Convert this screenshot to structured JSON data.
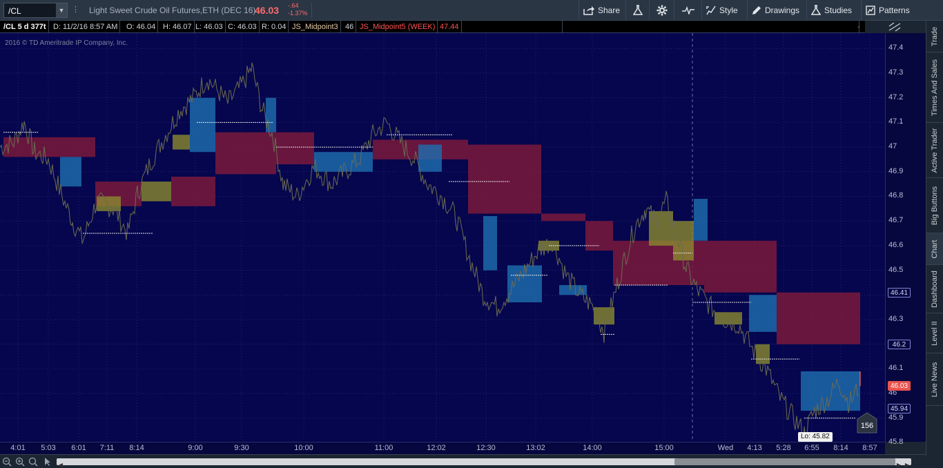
{
  "toolbar": {
    "symbol": "/CL",
    "instrument_name": "Light Sweet Crude Oil Futures,ETH (DEC 16)",
    "last_price": "46.03",
    "change": "-.64",
    "change_pct": "-1.37%",
    "share_label": "Share",
    "style_label": "Style",
    "drawings_label": "Drawings",
    "studies_label": "Studies",
    "patterns_label": "Patterns"
  },
  "chart_header": {
    "title": "/CL 5 d 377t",
    "date": "D: 11/2/16 8:57 AM",
    "open": "O: 46.04",
    "high": "H: 46.07",
    "low": "L: 46.03",
    "close": "C: 46.03",
    "range": "R: 0.04",
    "indicator1_name": "JS_Midpoint3",
    "indicator1_value": "46",
    "indicator2_name": "JS_Midpoint5 (WEEK)",
    "indicator2_value": "47.44"
  },
  "watermark": "2016 © TD Ameritrade IP Company, Inc.",
  "price_axis": {
    "labels": [
      "47.4",
      "47.3",
      "47.2",
      "47.1",
      "47",
      "46.9",
      "46.8",
      "46.7",
      "46.6",
      "46.5",
      "46.4",
      "46.3",
      "46.2",
      "46.1",
      "46",
      "45.9",
      "45.8"
    ],
    "tags": [
      {
        "value": "46.41",
        "color": "#d4d9ff",
        "bg": "#06073f",
        "border": "#8088d8"
      },
      {
        "value": "46.2",
        "color": "#d4d9ff",
        "bg": "#06073f",
        "border": "#8088d8"
      },
      {
        "value": "46.03",
        "color": "#ffffff",
        "bg": "#e8544e",
        "border": "#e8544e"
      },
      {
        "value": "45.94",
        "color": "#d4d9ff",
        "bg": "#06073f",
        "border": "#8088d8"
      }
    ]
  },
  "time_axis": [
    "4:01",
    "5:03",
    "6:01",
    "7:11",
    "8:14",
    "9:00",
    "9:30",
    "10:00",
    "11:00",
    "12:02",
    "12:30",
    "13:02",
    "14:00",
    "15:00",
    "Wed",
    "4:13",
    "5:28",
    "6:55",
    "8:14",
    "8:57"
  ],
  "low_label": "Lo: 45.82",
  "bubble_count": "156",
  "sidebar_tabs": [
    "Trade",
    "Times And Sales",
    "Active Trader",
    "Big Buttons",
    "Chart",
    "Dashboard",
    "Level II",
    "Live News"
  ],
  "colors": {
    "chart_bg": "#05064d",
    "price_line": "#6b6a50",
    "box_red": "#7a1a3c",
    "box_blue": "#1e6fb0",
    "box_yellow": "#8a8a30",
    "last_price": "#ff6b6b"
  },
  "chart_data": {
    "type": "line",
    "ylim": [
      45.78,
      47.44
    ],
    "x_ticks": [
      "4:01",
      "5:03",
      "6:01",
      "7:11",
      "8:14",
      "9:00",
      "9:30",
      "10:00",
      "11:00",
      "12:02",
      "12:30",
      "13:02",
      "14:00",
      "15:00",
      "Wed",
      "4:13",
      "5:28",
      "6:55",
      "8:14",
      "8:57"
    ],
    "price_path": [
      [
        0,
        47.0
      ],
      [
        20,
        47.02
      ],
      [
        35,
        47.1
      ],
      [
        50,
        46.98
      ],
      [
        70,
        46.95
      ],
      [
        90,
        46.8
      ],
      [
        105,
        46.7
      ],
      [
        120,
        46.62
      ],
      [
        140,
        46.78
      ],
      [
        165,
        46.75
      ],
      [
        185,
        46.65
      ],
      [
        200,
        46.82
      ],
      [
        220,
        46.95
      ],
      [
        240,
        47.05
      ],
      [
        260,
        47.15
      ],
      [
        280,
        47.2
      ],
      [
        300,
        47.28
      ],
      [
        330,
        47.18
      ],
      [
        350,
        47.25
      ],
      [
        365,
        47.32
      ],
      [
        380,
        47.15
      ],
      [
        395,
        47.05
      ],
      [
        410,
        46.85
      ],
      [
        430,
        46.8
      ],
      [
        455,
        46.92
      ],
      [
        480,
        46.85
      ],
      [
        500,
        46.9
      ],
      [
        520,
        46.95
      ],
      [
        540,
        47.05
      ],
      [
        560,
        47.1
      ],
      [
        580,
        47.02
      ],
      [
        600,
        46.95
      ],
      [
        620,
        46.85
      ],
      [
        640,
        46.8
      ],
      [
        660,
        46.72
      ],
      [
        680,
        46.55
      ],
      [
        700,
        46.4
      ],
      [
        720,
        46.35
      ],
      [
        740,
        46.42
      ],
      [
        760,
        46.5
      ],
      [
        780,
        46.58
      ],
      [
        800,
        46.62
      ],
      [
        820,
        46.48
      ],
      [
        840,
        46.4
      ],
      [
        860,
        46.35
      ],
      [
        875,
        46.25
      ],
      [
        890,
        46.4
      ],
      [
        905,
        46.55
      ],
      [
        920,
        46.68
      ],
      [
        935,
        46.75
      ],
      [
        950,
        46.7
      ],
      [
        965,
        46.78
      ],
      [
        980,
        46.65
      ],
      [
        995,
        46.5
      ],
      [
        1010,
        46.42
      ],
      [
        1030,
        46.35
      ],
      [
        1050,
        46.3
      ],
      [
        1070,
        46.28
      ],
      [
        1090,
        46.18
      ],
      [
        1110,
        46.1
      ],
      [
        1130,
        45.98
      ],
      [
        1150,
        45.9
      ],
      [
        1165,
        45.84
      ],
      [
        1180,
        45.93
      ],
      [
        1200,
        45.98
      ],
      [
        1215,
        46.05
      ],
      [
        1230,
        45.96
      ],
      [
        1245,
        46.03
      ]
    ],
    "levels": [
      {
        "x0": 5,
        "x1": 55,
        "value": 47.06
      },
      {
        "x0": 120,
        "x1": 222,
        "value": 46.65
      },
      {
        "x0": 285,
        "x1": 395,
        "value": 47.1
      },
      {
        "x0": 400,
        "x1": 540,
        "value": 47.0
      },
      {
        "x0": 560,
        "x1": 655,
        "value": 47.05
      },
      {
        "x0": 650,
        "x1": 738,
        "value": 46.86
      },
      {
        "x0": 795,
        "x1": 868,
        "value": 46.6
      },
      {
        "x0": 740,
        "x1": 793,
        "value": 46.48
      },
      {
        "x0": 890,
        "x1": 968,
        "value": 46.44
      },
      {
        "x0": 975,
        "x1": 1003,
        "value": 46.57
      },
      {
        "x0": 1003,
        "x1": 1088,
        "value": 46.37
      },
      {
        "x0": 1088,
        "x1": 1158,
        "value": 46.14
      },
      {
        "x0": 1165,
        "x1": 1240,
        "value": 45.9
      },
      {
        "x0": 870,
        "x1": 890,
        "value": 46.24
      }
    ],
    "zones": [
      {
        "x0": 5,
        "x1": 138,
        "top": 47.04,
        "bottom": 46.96,
        "color": "box_red"
      },
      {
        "x0": 138,
        "x1": 205,
        "top": 46.86,
        "bottom": 46.76,
        "color": "box_red"
      },
      {
        "x0": 205,
        "x1": 248,
        "top": 46.86,
        "bottom": 46.78,
        "color": "box_yellow"
      },
      {
        "x0": 248,
        "x1": 312,
        "top": 46.88,
        "bottom": 46.76,
        "color": "box_red"
      },
      {
        "x0": 312,
        "x1": 400,
        "top": 47.06,
        "bottom": 46.89,
        "color": "box_red"
      },
      {
        "x0": 400,
        "x1": 455,
        "top": 47.06,
        "bottom": 46.93,
        "color": "box_red"
      },
      {
        "x0": 455,
        "x1": 540,
        "top": 46.98,
        "bottom": 46.9,
        "color": "box_blue"
      },
      {
        "x0": 540,
        "x1": 678,
        "top": 47.03,
        "bottom": 46.95,
        "color": "box_red"
      },
      {
        "x0": 678,
        "x1": 784,
        "top": 47.01,
        "bottom": 46.73,
        "color": "box_red"
      },
      {
        "x0": 784,
        "x1": 848,
        "top": 46.73,
        "bottom": 46.7,
        "color": "box_red"
      },
      {
        "x0": 848,
        "x1": 888,
        "top": 46.7,
        "bottom": 46.58,
        "color": "box_red"
      },
      {
        "x0": 888,
        "x1": 1020,
        "top": 46.62,
        "bottom": 46.44,
        "color": "box_red"
      },
      {
        "x0": 1020,
        "x1": 1125,
        "top": 46.62,
        "bottom": 46.41,
        "color": "box_red"
      },
      {
        "x0": 1125,
        "x1": 1246,
        "top": 46.41,
        "bottom": 46.2,
        "color": "box_red"
      },
      {
        "x0": 1005,
        "x1": 1025,
        "top": 46.79,
        "bottom": 46.62,
        "color": "box_blue"
      },
      {
        "x0": 700,
        "x1": 720,
        "top": 46.72,
        "bottom": 46.5,
        "color": "box_blue"
      },
      {
        "x0": 1085,
        "x1": 1125,
        "top": 46.4,
        "bottom": 46.25,
        "color": "box_blue"
      },
      {
        "x0": 1160,
        "x1": 1246,
        "top": 46.09,
        "bottom": 45.93,
        "color": "box_blue"
      },
      {
        "x0": 385,
        "x1": 400,
        "top": 47.2,
        "bottom": 47.06,
        "color": "box_blue"
      },
      {
        "x0": 275,
        "x1": 312,
        "top": 47.2,
        "bottom": 46.98,
        "color": "box_blue"
      },
      {
        "x0": 87,
        "x1": 118,
        "top": 46.96,
        "bottom": 46.84,
        "color": "box_blue"
      },
      {
        "x0": 606,
        "x1": 640,
        "top": 47.01,
        "bottom": 46.9,
        "color": "box_blue"
      },
      {
        "x0": 735,
        "x1": 785,
        "top": 46.52,
        "bottom": 46.37,
        "color": "box_blue"
      },
      {
        "x0": 810,
        "x1": 850,
        "top": 46.44,
        "bottom": 46.4,
        "color": "box_blue"
      },
      {
        "x0": 940,
        "x1": 975,
        "top": 46.74,
        "bottom": 46.6,
        "color": "box_yellow"
      },
      {
        "x0": 975,
        "x1": 1005,
        "top": 46.7,
        "bottom": 46.54,
        "color": "box_yellow"
      },
      {
        "x0": 1035,
        "x1": 1075,
        "top": 46.33,
        "bottom": 46.28,
        "color": "box_yellow"
      },
      {
        "x0": 1095,
        "x1": 1115,
        "top": 46.2,
        "bottom": 46.12,
        "color": "box_yellow"
      },
      {
        "x0": 140,
        "x1": 175,
        "top": 46.8,
        "bottom": 46.74,
        "color": "box_yellow"
      },
      {
        "x0": 250,
        "x1": 275,
        "top": 47.05,
        "bottom": 46.99,
        "color": "box_yellow"
      },
      {
        "x0": 780,
        "x1": 810,
        "top": 46.62,
        "bottom": 46.58,
        "color": "box_yellow"
      },
      {
        "x0": 860,
        "x1": 890,
        "top": 46.35,
        "bottom": 46.28,
        "color": "box_yellow"
      }
    ]
  }
}
